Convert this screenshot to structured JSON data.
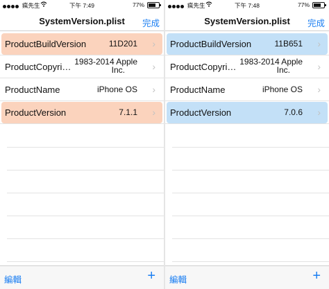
{
  "left": {
    "status": {
      "carrier": "瘋先生",
      "time": "下午 7:49",
      "battery_pct": "77%",
      "battery_level": 0.77
    },
    "nav": {
      "title": "SystemVersion.plist",
      "done": "完成"
    },
    "rows": [
      {
        "key": "ProductBuildVersion",
        "value": "11D201"
      },
      {
        "key": "ProductCopyri…",
        "value_line1": "1983-2014 Apple",
        "value_line2": "Inc."
      },
      {
        "key": "ProductName",
        "value": "iPhone OS"
      },
      {
        "key": "ProductVersion",
        "value": "7.1.1"
      }
    ],
    "toolbar": {
      "edit": "編輯",
      "add": "+"
    }
  },
  "right": {
    "status": {
      "carrier": "瘋先生",
      "time": "下午 7:48",
      "battery_pct": "77%",
      "battery_level": 0.77
    },
    "nav": {
      "title": "SystemVersion.plist",
      "done": "完成"
    },
    "rows": [
      {
        "key": "ProductBuildVersion",
        "value": "11B651"
      },
      {
        "key": "ProductCopyri…",
        "value_line1": "1983-2014 Apple",
        "value_line2": "Inc."
      },
      {
        "key": "ProductName",
        "value": "iPhone OS"
      },
      {
        "key": "ProductVersion",
        "value": "7.0.6"
      }
    ],
    "toolbar": {
      "edit": "編輯",
      "add": "+"
    }
  },
  "colors": {
    "accent": "#1a7ef2",
    "highlight_left": "#fbd3bd",
    "highlight_right": "#c3e0f7"
  },
  "icons": [
    "signal-dots-icon",
    "wifi-icon",
    "battery-icon",
    "chevron-right-icon",
    "plus-icon"
  ]
}
